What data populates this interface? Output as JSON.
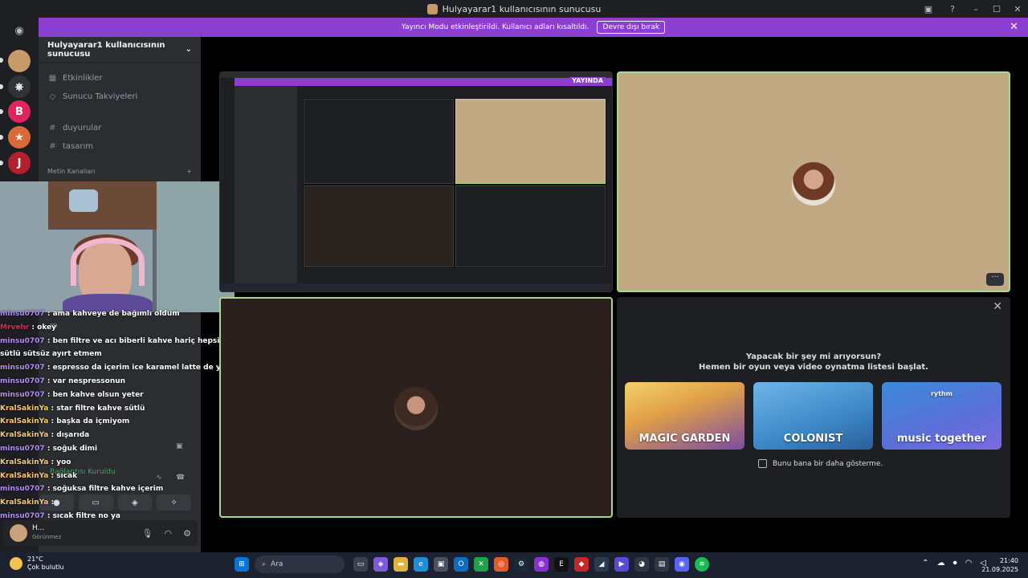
{
  "window": {
    "title": "Hulyayarar1 kullanıcısının sunucusu"
  },
  "notice": {
    "text": "Yayıncı Modu etkinleştirildi. Kullanıcı adları kısaltıldı.",
    "button": "Devre dışı bırak"
  },
  "sidebar": {
    "server_name": "Hulyayarar1 kullanıcısının sunucusu",
    "items": [
      {
        "label": "Etkinlikler"
      },
      {
        "label": "Sunucu Takviyeleri"
      },
      {
        "label": "duyurular"
      },
      {
        "label": "tasarım"
      }
    ],
    "category": "Metin Kanalları"
  },
  "chat": [
    {
      "user": "minsu0707",
      "text": "ama kahveye de bağımlı oldum",
      "color": "#b48ef0"
    },
    {
      "user": "Mrvehr",
      "text": "okey",
      "color": "#e0245e"
    },
    {
      "user": "minsu0707",
      "text": "ben filtre ve acı biberli kahve hariç hepsini içerim sütlü sütsüz ayırt etmem",
      "color": "#b48ef0"
    },
    {
      "user": "minsu0707",
      "text": "espresso da içerim ice karamel latte de yani",
      "color": "#b48ef0"
    },
    {
      "user": "minsu0707",
      "text": "var nespressonun",
      "color": "#b48ef0"
    },
    {
      "user": "minsu0707",
      "text": "ben kahve olsun yeter",
      "color": "#b48ef0"
    },
    {
      "user": "KralSakinYa",
      "text": "star filtre kahve sütlü",
      "color": "#f5c97a"
    },
    {
      "user": "KralSakinYa",
      "text": "başka da içmiyom",
      "color": "#f5c97a"
    },
    {
      "user": "KralSakinYa",
      "text": "dışarıda",
      "color": "#f5c97a"
    },
    {
      "user": "minsu0707",
      "text": "soğuk dimi",
      "color": "#b48ef0"
    },
    {
      "user": "KralSakinYa",
      "text": "yoo",
      "color": "#f5c97a"
    },
    {
      "user": "KralSakinYa",
      "text": "sıcak",
      "color": "#f5c97a"
    },
    {
      "user": "minsu0707",
      "text": "soğuksa filtre kahve içerim",
      "color": "#b48ef0"
    },
    {
      "user": "KralSakinYa",
      "text": "",
      "color": "#f5c97a"
    },
    {
      "user": "minsu0707",
      "text": "sıcak filtre no ya",
      "color": "#b48ef0"
    }
  ],
  "ghost": {
    "rp": "rp",
    "voice": "Bağlantısı Kuruldu"
  },
  "user_panel": {
    "name": "H...",
    "status": "Görünmez"
  },
  "stage": {
    "live_badge": "YAYINDA",
    "activity": {
      "heading_line1": "Yapacak bir şey mi arıyorsun?",
      "heading_line2": "Hemen bir oyun veya video oynatma listesi başlat.",
      "cards": [
        {
          "title": "MAGIC GARDEN"
        },
        {
          "title": "COLONIST"
        },
        {
          "title": "music together",
          "brand": "rythm"
        }
      ],
      "checkbox": "Bunu bana bir daha gösterme."
    }
  },
  "taskbar": {
    "temp": "21°C",
    "weather": "Çok bulutlu",
    "search": "Ara",
    "time": "21:40",
    "date": "21.09.2025"
  }
}
